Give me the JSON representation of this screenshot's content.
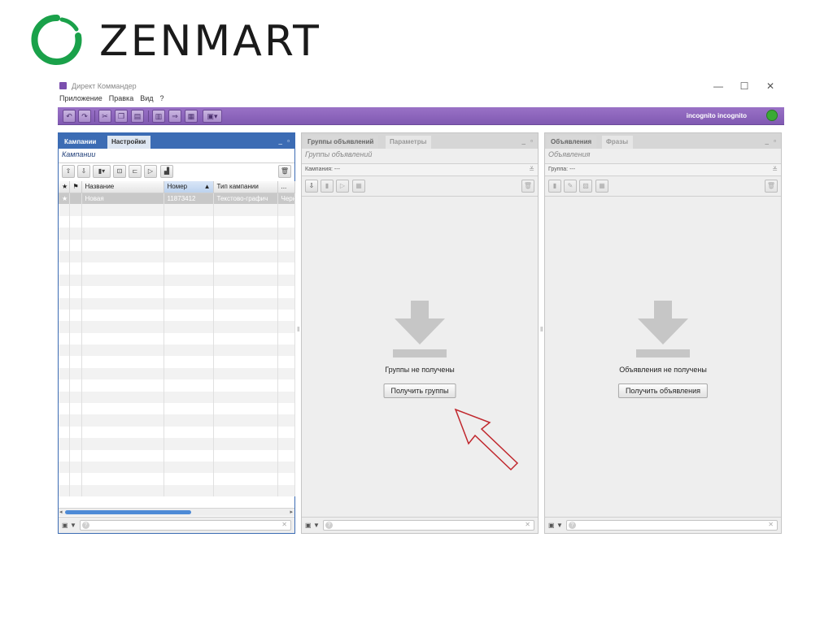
{
  "logo": {
    "text": "ZENMART",
    "color": "#1aa14a"
  },
  "window": {
    "title": "Директ Коммандер",
    "controls": [
      "—",
      "☐",
      "✕"
    ],
    "menu": [
      "Приложение",
      "Правка",
      "Вид",
      "?"
    ],
    "accent": "#8a63b9"
  },
  "toolbar": {
    "buttons": [
      "undo-icon",
      "redo-icon",
      "cut-icon",
      "copy-icon",
      "paste-icon",
      "chart-icon",
      "import-icon",
      "table-icon",
      "view-dropdown-icon"
    ],
    "user": "incognito incognito",
    "user_icon": "user-status-icon"
  },
  "campaigns": {
    "tabs": [
      "Кампании",
      "Настройки"
    ],
    "subtitle": "Кампании",
    "columns": [
      "Название",
      "Номер",
      "Тип кампании",
      "..."
    ],
    "rows": [
      {
        "name": "Новая",
        "number": "11873412",
        "type": "Текстово-графич",
        "extra": "Черн"
      }
    ],
    "blank_rows": 25
  },
  "groups": {
    "tabs": [
      "Группы объявлений",
      "Параметры"
    ],
    "subtitle": "Группы объявлений",
    "filter": "Кампания: ---",
    "empty_text": "Группы не получены",
    "button": "Получить группы"
  },
  "ads": {
    "tabs": [
      "Объявления",
      "Фразы"
    ],
    "subtitle": "Объявления",
    "filter": "Группа: ---",
    "empty_text": "Объявления не получены",
    "button": "Получить объявления"
  },
  "annotation": {
    "color": "#c0272d"
  }
}
